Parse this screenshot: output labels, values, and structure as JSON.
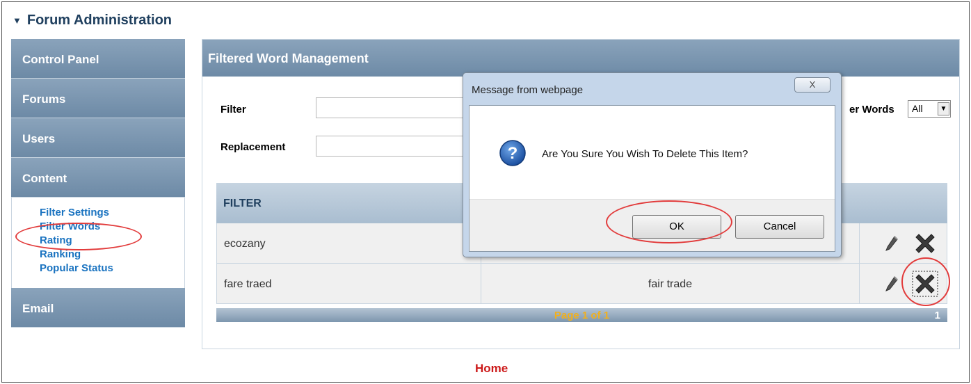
{
  "header": {
    "title": "Forum Administration"
  },
  "sidebar": {
    "items": [
      {
        "label": "Control Panel"
      },
      {
        "label": "Forums"
      },
      {
        "label": "Users"
      },
      {
        "label": "Content"
      }
    ],
    "content_subitems": [
      {
        "label": "Filter Settings"
      },
      {
        "label": "Filter Words"
      },
      {
        "label": "Rating"
      },
      {
        "label": "Ranking"
      },
      {
        "label": "Popular Status"
      }
    ],
    "email_label": "Email"
  },
  "panel": {
    "title": "Filtered Word Management",
    "filter_label": "Filter",
    "replacement_label": "Replacement",
    "show_label": "er Words",
    "show_select_value": "All",
    "table": {
      "header": "FILTER",
      "rows": [
        {
          "filter": "ecozany",
          "replacement": ""
        },
        {
          "filter": "fare traed",
          "replacement": "fair trade"
        }
      ]
    },
    "pager": {
      "text": "Page 1 of 1",
      "page_number": "1"
    }
  },
  "footer": {
    "home_link": "Home"
  },
  "dialog": {
    "title": "Message from webpage",
    "close_glyph": "X",
    "message": "Are You Sure You Wish To Delete This Item?",
    "ok_label": "OK",
    "cancel_label": "Cancel"
  },
  "colors": {
    "sidebar_bg": "#7a95ae",
    "link_blue": "#1a73c0",
    "home_red": "#cc1a1a",
    "annotation_red": "#e23b3b",
    "pager_text": "#f0b020"
  }
}
